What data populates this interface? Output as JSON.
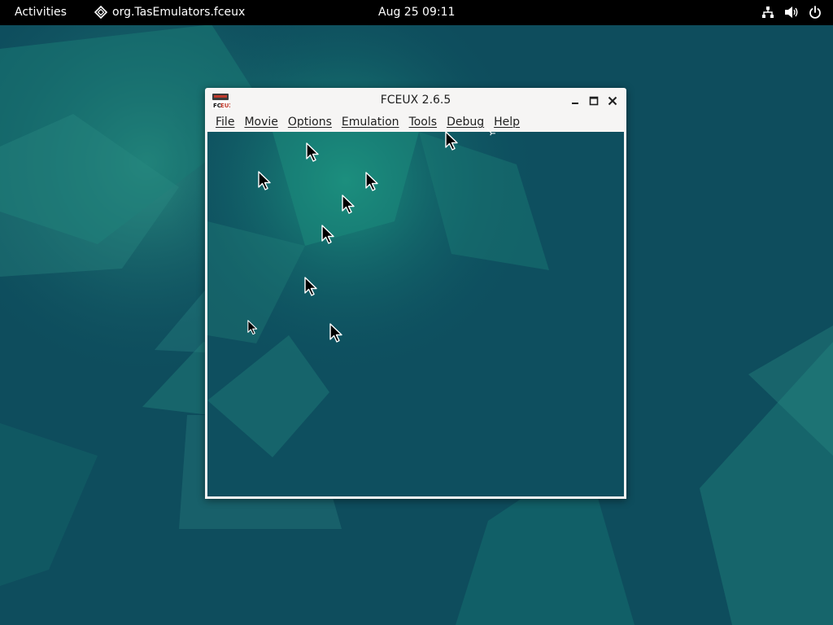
{
  "topbar": {
    "activities_label": "Activities",
    "app_name": "org.TasEmulators.fceux",
    "clock": "Aug 25  09:11",
    "status_icons": [
      "network-icon",
      "volume-icon",
      "power-icon"
    ]
  },
  "window": {
    "title": "FCEUX 2.6.5",
    "icon": "fceux-app-icon",
    "controls": [
      "minimize-icon",
      "maximize-icon",
      "close-icon"
    ],
    "menu": [
      {
        "label": "File"
      },
      {
        "label": "Movie"
      },
      {
        "label": "Options"
      },
      {
        "label": "Emulation"
      },
      {
        "label": "Tools"
      },
      {
        "label": "Debug"
      },
      {
        "label": "Help"
      }
    ]
  },
  "desktop": {
    "wallpaper": "debian-emerald-wallpaper",
    "logo": "debian-swirl-icon",
    "cursor_trail_icon": "mouse-pointer-icon"
  },
  "colors": {
    "topbar_bg": "#000000",
    "wallpaper_dark": "#0d4c5c",
    "wallpaper_teal": "#1f8a7a",
    "window_bg": "#f6f5f4"
  }
}
